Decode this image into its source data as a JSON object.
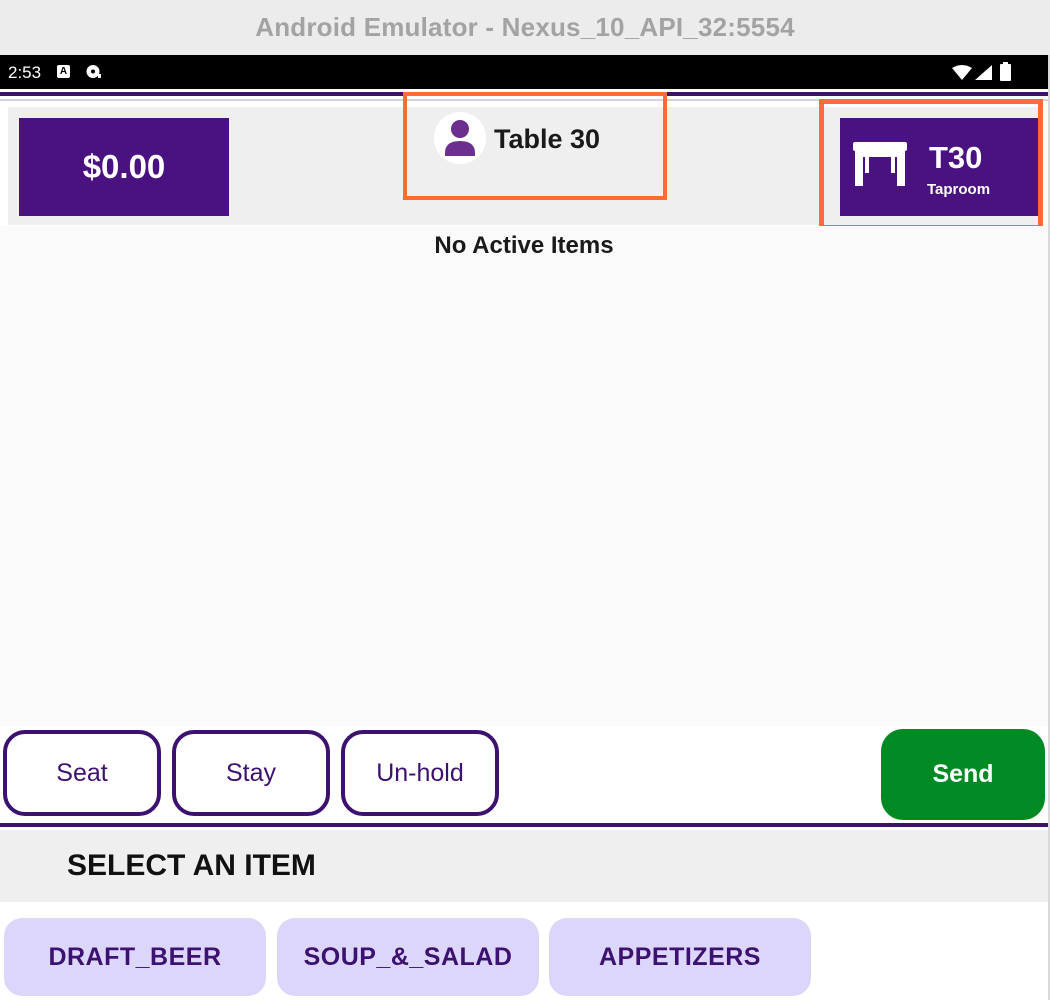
{
  "emulator": {
    "title": "Android Emulator - Nexus_10_API_32:5554"
  },
  "status_bar": {
    "time": "2:53",
    "icons": [
      "a-notification-icon",
      "disc-icon",
      "wifi-icon",
      "signal-icon",
      "battery-icon"
    ]
  },
  "header": {
    "total": "$0.00",
    "table_name": "Table 30",
    "table_button": {
      "number": "T30",
      "room": "Taproom"
    }
  },
  "order": {
    "empty_message": "No Active Items"
  },
  "actions": {
    "seat": "Seat",
    "stay": "Stay",
    "unhold": "Un-hold",
    "send": "Send"
  },
  "menu": {
    "title": "SELECT AN ITEM",
    "categories": [
      "DRAFT_BEER",
      "SOUP_&_SALAD",
      "APPETIZERS"
    ]
  },
  "colors": {
    "primary": "#4a1280",
    "accent_highlight": "#ff6b36",
    "send_green": "#018a24",
    "category_bg": "#ddd6fb"
  }
}
